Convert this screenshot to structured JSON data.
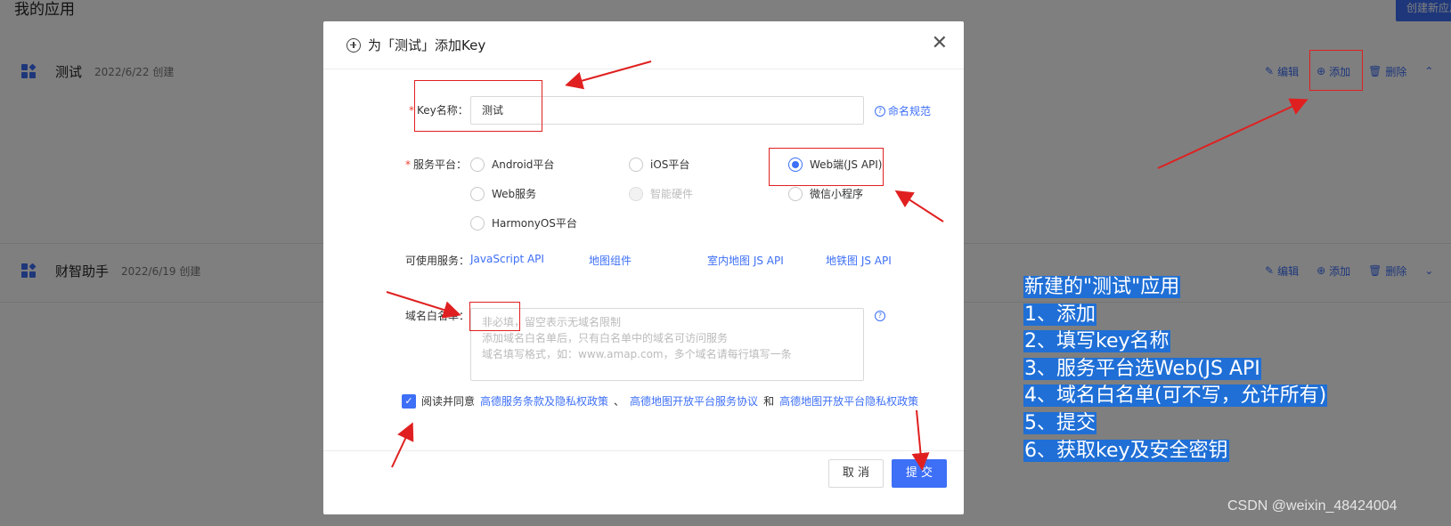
{
  "page": {
    "title": "我的应用",
    "create_button": "创建新应用"
  },
  "apps": [
    {
      "name": "测试",
      "date": "2022/6/22 创建",
      "actions": {
        "edit": "编辑",
        "add": "添加",
        "delete": "删除"
      }
    },
    {
      "name": "财智助手",
      "date": "2022/6/19 创建",
      "actions": {
        "edit": "编辑",
        "add": "添加",
        "delete": "删除"
      }
    }
  ],
  "modal": {
    "title": "为「测试」添加Key",
    "key_name": {
      "label": "Key名称：",
      "value": "测试",
      "help": "命名规范"
    },
    "platform": {
      "label": "服务平台：",
      "options": [
        "Android平台",
        "iOS平台",
        "Web端(JS API)",
        "Web服务",
        "智能硬件",
        "微信小程序",
        "HarmonyOS平台"
      ],
      "selected": "Web端(JS API)",
      "disabled": [
        "智能硬件"
      ]
    },
    "services": {
      "label": "可使用服务：",
      "items": [
        "JavaScript API",
        "地图组件",
        "室内地图 JS API",
        "地铁图 JS API"
      ]
    },
    "whitelist": {
      "label": "域名白名单：",
      "placeholder_lines": [
        "非必填，留空表示无域名限制",
        "添加域名白名单后，只有白名单中的域名可访问服务",
        "域名填写格式，如：www.amap.com，多个域名请每行填写一条"
      ]
    },
    "agreement": {
      "prefix": "阅读并同意",
      "link1": "高德服务条款及隐私权政策",
      "sep": "、",
      "link2": "高德地图开放平台服务协议",
      "and": "和",
      "link3": "高德地图开放平台隐私权政策",
      "checked": true
    },
    "buttons": {
      "cancel": "取 消",
      "submit": "提 交"
    }
  },
  "annotation": {
    "lines": [
      "新建的\"测试\"应用",
      "1、添加",
      "2、填写key名称",
      "3、服务平台选Web(JS API",
      "4、域名白名单(可不写，允许所有)",
      "5、提交",
      "6、获取key及安全密钥"
    ]
  },
  "watermark": "CSDN @weixin_48424004",
  "colors": {
    "primary": "#3d6ff7",
    "required": "#f04134",
    "annotation_red": "#e02020",
    "note_bg": "#1f6fd6"
  }
}
